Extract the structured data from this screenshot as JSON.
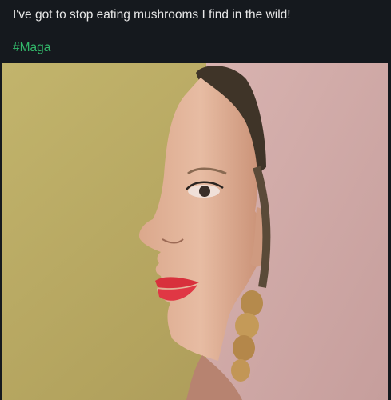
{
  "post": {
    "text": "I've got to stop eating mushrooms I find in the wild!",
    "hashtag": "#Maga"
  },
  "colors": {
    "background": "#15191e",
    "text": "#e8e8e8",
    "hashtag": "#32b86a",
    "wall_left": "#b9a862",
    "wall_right": "#cfa7a4"
  },
  "icons": [
    "optical-illusion-face-image"
  ]
}
